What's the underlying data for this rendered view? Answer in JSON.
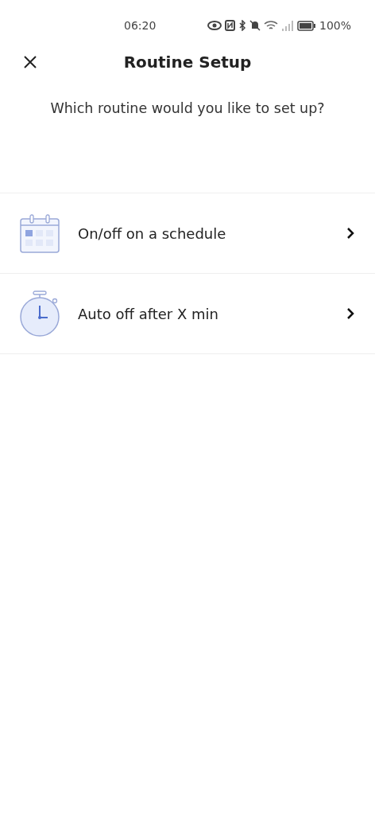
{
  "status_bar": {
    "time": "06:20",
    "battery": "100%"
  },
  "header": {
    "title": "Routine Setup"
  },
  "prompt": "Which routine would you like to set up?",
  "routines": [
    {
      "kind": "calendar",
      "label": "On/off on a schedule"
    },
    {
      "kind": "stopwatch",
      "label": "Auto off after X min"
    }
  ]
}
